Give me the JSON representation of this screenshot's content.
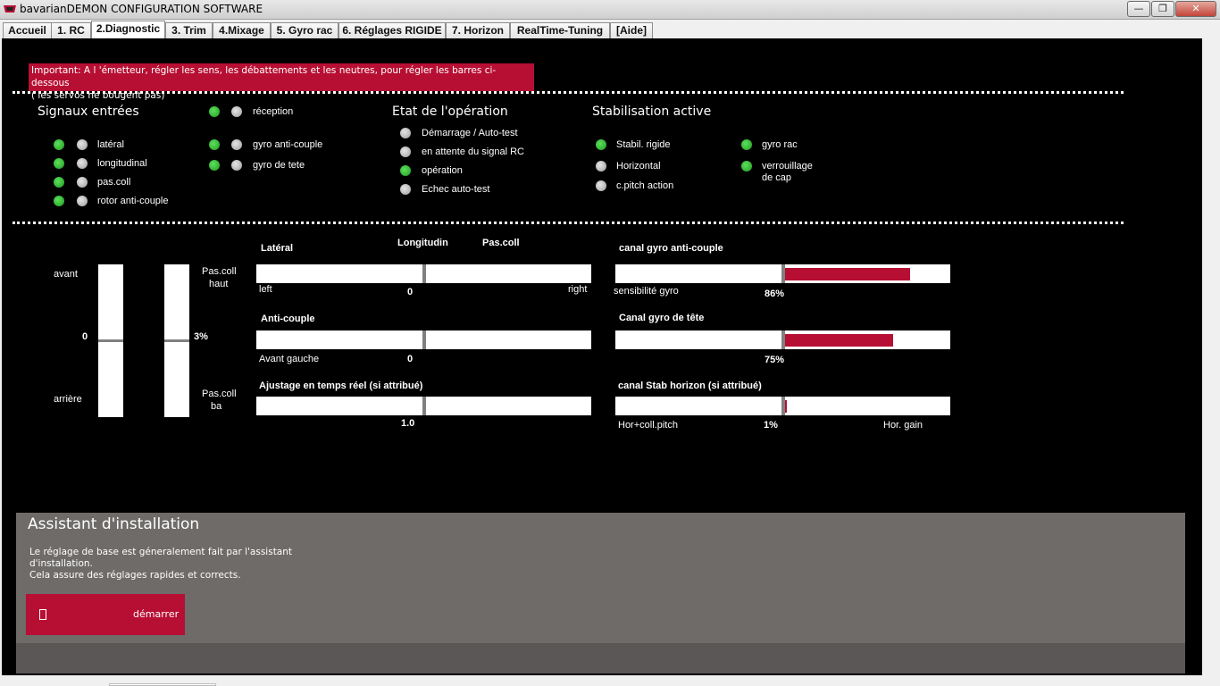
{
  "window": {
    "title": "bavarianDEMON CONFIGURATION SOFTWARE",
    "min": "—",
    "max": "❐",
    "close": "✕"
  },
  "tabs": [
    "Accueil",
    "1. RC",
    "2.Diagnostic",
    "3. Trim",
    "4.Mixage",
    "5. Gyro rac",
    "6. Réglages RIGIDE",
    "7. Horizon",
    "RealTime-Tuning",
    "[Aide]"
  ],
  "active_tab": "2.Diagnostic",
  "important": {
    "line1": "Important: A  l 'émetteur, régler les sens, les débattements et les neutres, pour régler les barres ci-dessous",
    "line2": "( les servos ne bougent pas)"
  },
  "signals": {
    "heading": "Signaux entrées",
    "items": [
      {
        "label": "latéral",
        "led1": "green",
        "led2": "gray"
      },
      {
        "label": "longitudinal",
        "led1": "green",
        "led2": "gray"
      },
      {
        "label": "pas.coll",
        "led1": "green",
        "led2": "gray"
      },
      {
        "label": "rotor anti-couple",
        "led1": "green",
        "led2": "gray"
      },
      {
        "label": "réception",
        "led1": "green",
        "led2": "gray"
      },
      {
        "label": "gyro anti-couple",
        "led1": "green",
        "led2": "gray"
      },
      {
        "label": "gyro de tete",
        "led1": "green",
        "led2": "gray"
      }
    ]
  },
  "operation": {
    "heading": "Etat de l'opération",
    "items": [
      {
        "label": "Démarrage / Auto-test",
        "led": "gray"
      },
      {
        "label": "en attente du signal RC",
        "led": "gray"
      },
      {
        "label": "opération",
        "led": "green"
      },
      {
        "label": "Echec auto-test",
        "led": "gray"
      }
    ]
  },
  "stabilisation": {
    "heading": "Stabilisation active",
    "items": [
      {
        "label": "Stabil. rigide",
        "led": "green"
      },
      {
        "label": "Horizontal",
        "led": "gray"
      },
      {
        "label": "c.pitch action",
        "led": "gray"
      },
      {
        "label": "gyro rac",
        "led": "green"
      },
      {
        "label": "verrouillage",
        "led": "green"
      },
      {
        "label": "de cap",
        "led": ""
      }
    ]
  },
  "sticks": {
    "avant": "avant",
    "zero": "0",
    "arriere": "arrière",
    "pascoll_haut1": "Pas.coll",
    "pascoll_haut2": "haut",
    "pascoll_value": "3%",
    "pascoll_bas1": "Pas.coll",
    "pascoll_bas2": "ba"
  },
  "bars": {
    "lateral": {
      "title": "Latéral",
      "left": "left",
      "right": "right",
      "value": "0",
      "fill": 0
    },
    "longitudin": {
      "title": "Longitudin"
    },
    "pascoll": {
      "title": "Pas.coll"
    },
    "anticouple": {
      "title": "Anti-couple",
      "sub": "Avant gauche",
      "value": "0",
      "fill": 0
    },
    "ajustage": {
      "title": "Ajustage en temps réel (si attribué)",
      "value": "1.0",
      "fill": 0
    },
    "gyro_anticouple": {
      "title": "canal gyro anti-couple",
      "sub": "sensibilité gyro",
      "value": "86%",
      "fill": 0.74
    },
    "gyro_tete": {
      "title": "Canal gyro de tête",
      "value": "75%",
      "fill": 0.65
    },
    "stab_horizon": {
      "title": "canal Stab horizon (si attribué)",
      "left": "Hor+coll.pitch",
      "value": "1%",
      "right": "Hor. gain",
      "fill": 0.01
    }
  },
  "wizard": {
    "title": "Assistant d'installation",
    "line1": "Le réglage de base est géneralement fait par l'assistant",
    "line2": "d'installation.",
    "line3": "Cela assure des réglages rapides et corrects.",
    "button": "démarrer"
  },
  "colors": {
    "accent": "#b70f33",
    "led_green": "#2fb52f",
    "led_gray": "#c0c0c0",
    "panel": "#000000",
    "wizard_bg": "#6e6b69"
  }
}
